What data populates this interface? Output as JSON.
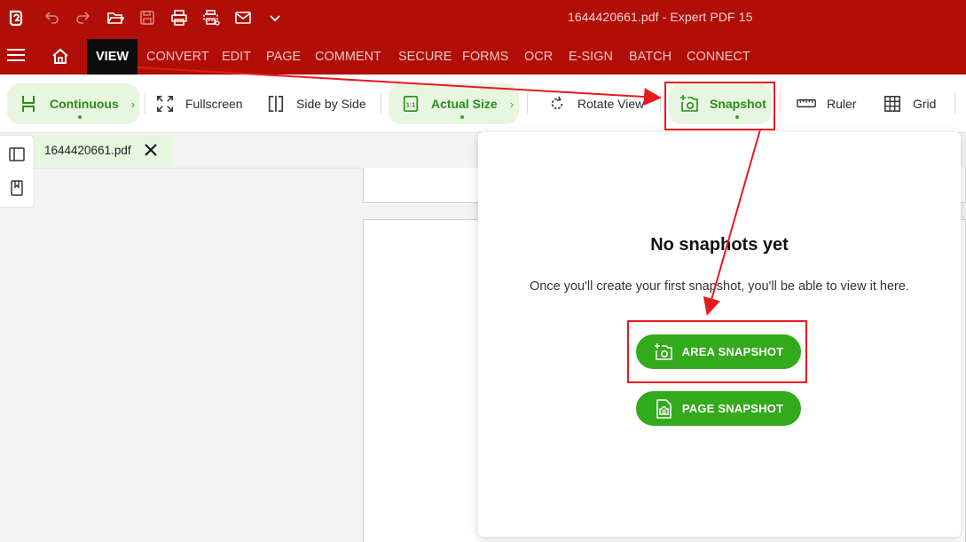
{
  "app": {
    "window_title": "1644420661.pdf   -   Expert PDF 15",
    "brand_color": "#b00e06",
    "accent_green": "#33a91c"
  },
  "quick_access": {
    "icons": [
      "app-logo-icon",
      "undo-icon",
      "redo-icon",
      "open-folder-icon",
      "save-icon",
      "print-icon",
      "print-settings-icon",
      "email-icon",
      "chevron-down-icon"
    ]
  },
  "menu": {
    "active": "VIEW",
    "items": [
      "CONVERT",
      "EDIT",
      "PAGE",
      "COMMENT",
      "SECURE",
      "FORMS",
      "OCR",
      "E-SIGN",
      "BATCH",
      "CONNECT"
    ]
  },
  "ribbon": {
    "continuous": "Continuous",
    "fullscreen": "Fullscreen",
    "side_by_side": "Side by Side",
    "actual_size": "Actual Size",
    "rotate_view": "Rotate View",
    "snapshot": "Snapshot",
    "ruler": "Ruler",
    "grid": "Grid"
  },
  "document_tab": {
    "name": "1644420661.pdf"
  },
  "snapshot_panel": {
    "title": "No snaphots yet",
    "message": "Once you'll create your first snapshot, you'll be able to view it here.",
    "area_button": "AREA SNAPSHOT",
    "page_button": "PAGE SNAPSHOT"
  },
  "annotation_color": "#e8181f"
}
